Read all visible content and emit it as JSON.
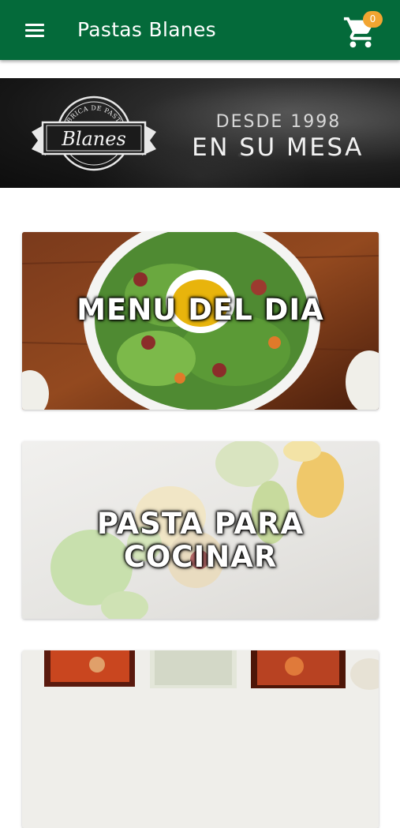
{
  "app_bar": {
    "title": "Pastas Blanes",
    "cart_count": "0",
    "colors": {
      "bar": "#046a3a",
      "badge": "#f2a531"
    }
  },
  "hero": {
    "logo_arc_text": "FÁBRICA DE PASTAS",
    "logo_text": "Blanes",
    "tagline_small": "DESDE 1998",
    "tagline_big": "EN SU MESA"
  },
  "categories": [
    {
      "label": "MENU DEL DIA"
    },
    {
      "label_line1": "PASTA PARA",
      "label_line2": "COCINAR"
    },
    {
      "label": ""
    }
  ]
}
